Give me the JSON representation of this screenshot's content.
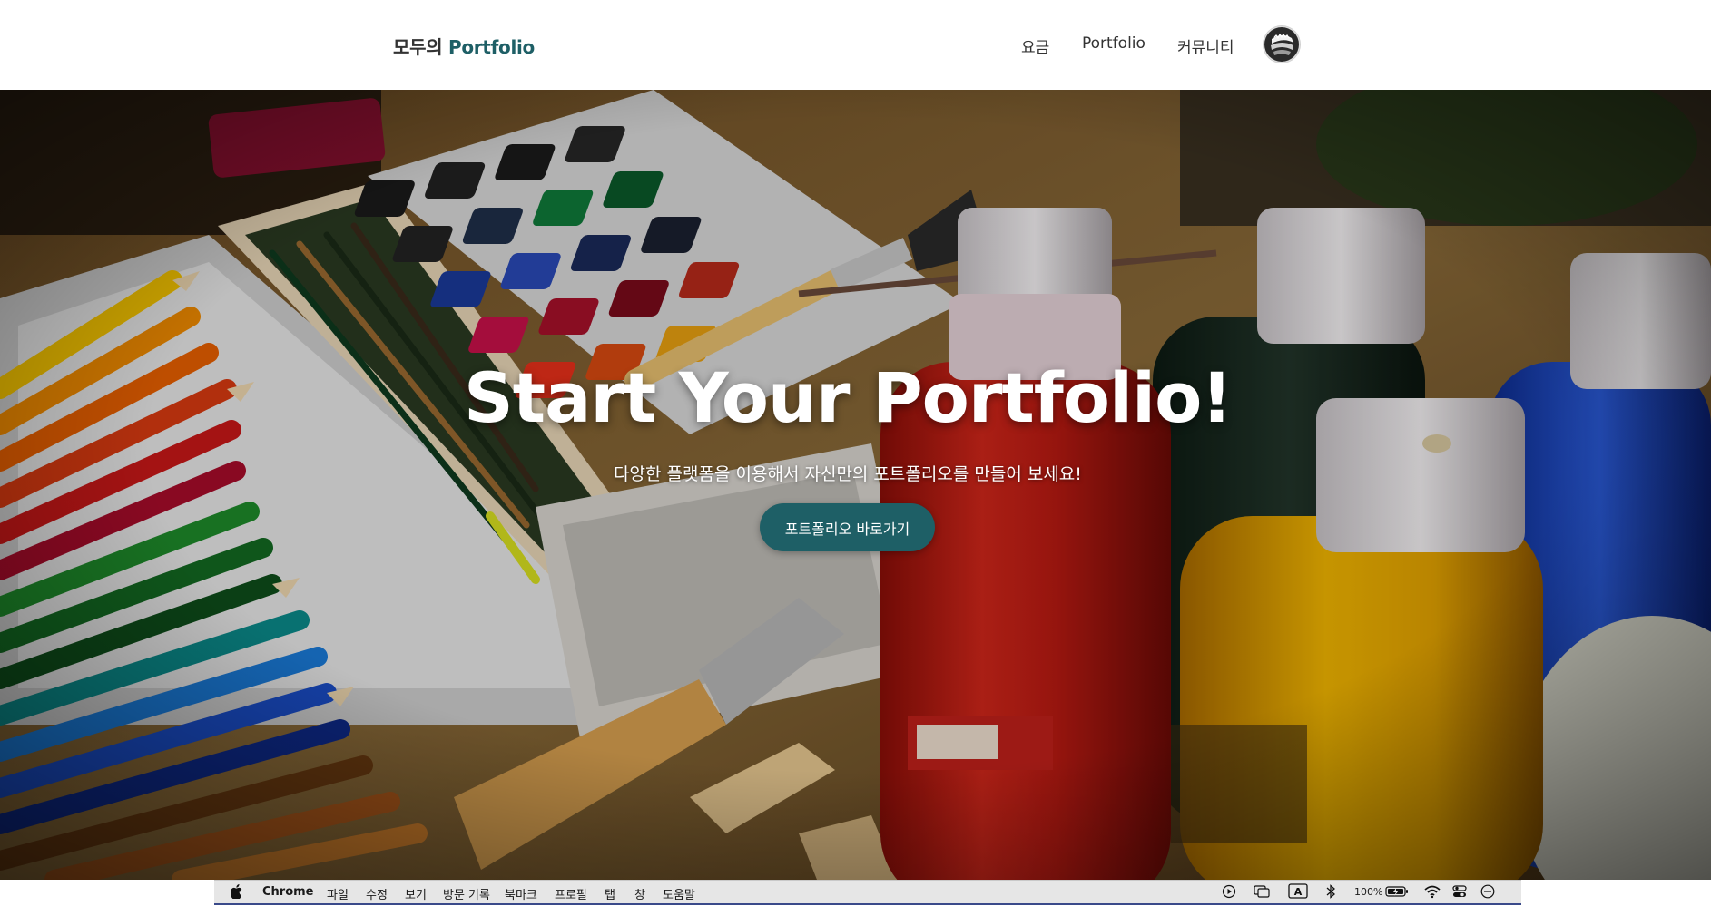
{
  "header": {
    "logo_prefix": "모두의",
    "logo_accent": "Portfolio",
    "nav": [
      "요금",
      "Portfolio",
      "커뮤니티"
    ],
    "avatar_icon": "user-avatar-icon"
  },
  "hero": {
    "title": "Start Your Portfolio!",
    "subtitle": "다양한 플랫폼을 이용해서 자신만의 포트폴리오를 만들어 보세요!",
    "cta_label": "포트폴리오 바로가기"
  },
  "menubar": {
    "app_name": "Chrome",
    "menus": [
      "파일",
      "수정",
      "보기",
      "방문 기록",
      "북마크",
      "프로필",
      "탭",
      "창",
      "도움말"
    ],
    "battery": "100%",
    "input_indicator": "A"
  },
  "colors": {
    "accent": "#1e5f66",
    "text_dark": "#333333",
    "header_bg": "#ffffff"
  }
}
